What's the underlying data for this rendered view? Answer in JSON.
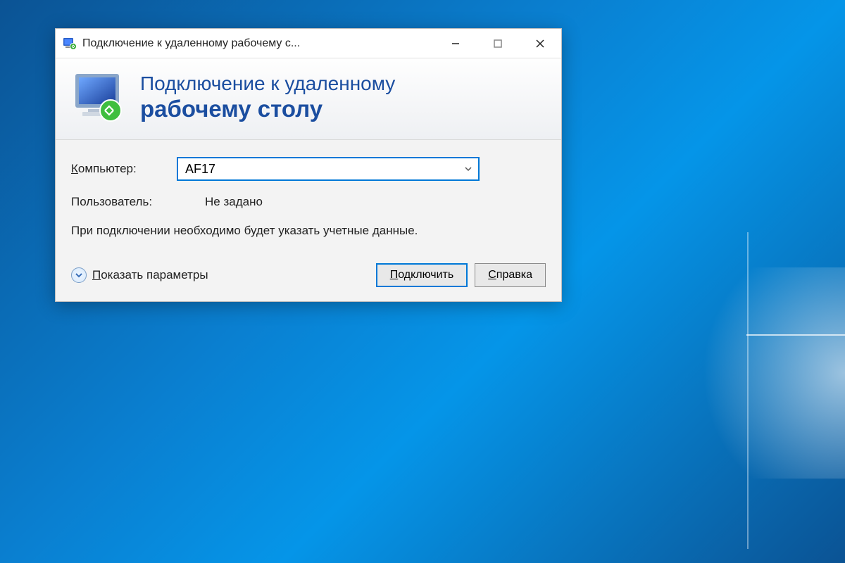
{
  "window": {
    "title": "Подключение к удаленному рабочему с..."
  },
  "banner": {
    "line1": "Подключение к удаленному",
    "line2": "рабочему столу"
  },
  "form": {
    "computer_label": "Компьютер:",
    "computer_label_accel": "К",
    "computer_value": "AF17",
    "user_label": "Пользователь:",
    "user_value": "Не задано",
    "hint": "При подключении необходимо будет указать учетные данные."
  },
  "footer": {
    "show_options": "Показать параметры",
    "show_options_accel": "П",
    "connect": "Подключить",
    "connect_accel": "П",
    "help": "Справка",
    "help_accel": "С"
  }
}
